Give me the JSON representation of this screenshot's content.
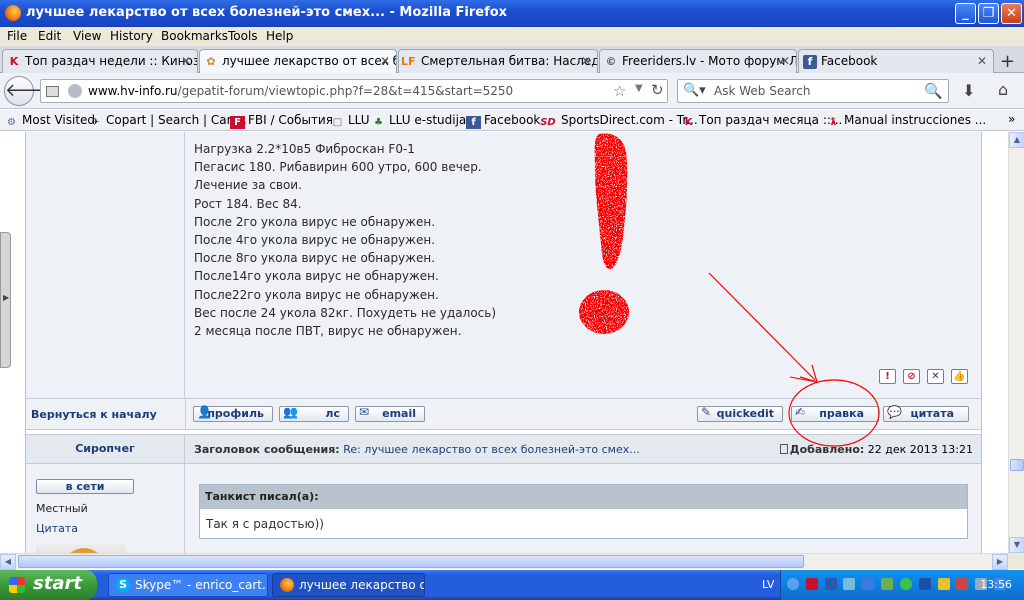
{
  "window": {
    "title": "лучшее лекарство от всех болезней-это смех... - Mozilla Firefox",
    "min_glyph": "_",
    "max_glyph": "❐",
    "close_glyph": "✕"
  },
  "menu": [
    "File",
    "Edit",
    "View",
    "History",
    "Bookmarks",
    "Tools",
    "Help"
  ],
  "tabs": [
    {
      "label": "Топ раздач недели :: Кинозал...",
      "icon_text": "K",
      "icon_color": "#c8102e"
    },
    {
      "label": "лучшее лекарство от всех бол...",
      "icon_text": "✿",
      "icon_color": "#d08a2a",
      "active": true
    },
    {
      "label": "Смертельная битва: Наследие...",
      "icon_text": "LF",
      "icon_color": "#e07b1a"
    },
    {
      "label": "Freeriders.lv - Мото форум Л...",
      "icon_text": "©",
      "icon_color": "#555555"
    },
    {
      "label": "Facebook",
      "icon_text": "f",
      "icon_color": "#3b5998"
    }
  ],
  "new_tab_glyph": "+",
  "nav": {
    "url_host": "www.hv-info.ru",
    "url_path": "/gepatit-forum/viewtopic.php?f=28&t=415&start=5250",
    "search_placeholder": "Ask Web Search"
  },
  "bookmarks": [
    {
      "label": "Most Visited",
      "icon": "⚙",
      "color": "#3b6fb6"
    },
    {
      "label": "Copart | Search | Car ...",
      "icon": "✈",
      "color": "#333333"
    },
    {
      "label": "FBI / События",
      "icon": "F",
      "color": "#c8102e"
    },
    {
      "label": "LLU",
      "icon": "□",
      "color": "#666666"
    },
    {
      "label": "LLU e-studijas",
      "icon": "♣",
      "color": "#2e7d32"
    },
    {
      "label": "Facebook",
      "icon": "f",
      "color": "#3b5998"
    },
    {
      "label": "SportsDirect.com - Tr...",
      "icon": "SD",
      "color": "#c8102e"
    },
    {
      "label": "Топ раздач месяца ::...",
      "icon": "K",
      "color": "#c8102e"
    },
    {
      "label": "Manual instrucciones ...",
      "icon": "ƛ",
      "color": "#c8102e"
    }
  ],
  "bookmarks_more": "»",
  "post1": {
    "lines": [
      "Нагрузка 2.2*10в5 Фиброскан F0-1",
      "Пегасис 180. Рибавирин 600 утро, 600 вечер.",
      "Лечение за свои.",
      "Рост 184. Вес 84.",
      "После 2го укола вирус не обнаружен.",
      "После 4го укола вирус не обнаружен.",
      "После 8го укола вирус не обнаружен.",
      "После14го укола вирус не обнаружен.",
      "После22го укола вирус не обнаружен.",
      "Вес после 24 укола 82кг. Похудеть не удалось)",
      "2 месяца после ПВТ, вирус не обнаружен."
    ],
    "back_to_top": "Вернуться к началу",
    "buttons": {
      "profile": "профиль",
      "pm": "лс",
      "email": "email",
      "quickedit": "quickedit",
      "edit": "правка",
      "quote": "цитата"
    },
    "mini_icons": [
      "!",
      "⊘",
      "✕",
      "👍"
    ]
  },
  "post2": {
    "author": "Сиропчег",
    "subject_label": "Заголовок сообщения:",
    "subject": "Re: лучшее лекарство от всех болезней-это смех...",
    "added_label": "Добавлено:",
    "added": "22 дек 2013 13:21",
    "online": "в сети",
    "rank": "Местный",
    "quote_link": "Цитата",
    "quote_author": "Танкист писал(а):",
    "quote_text": "Так я с радостью))"
  },
  "taskbar": {
    "start": "start",
    "tasks": [
      {
        "label": "Skype™ - enrico_cart...",
        "icon": "S",
        "color": "#00aff0"
      },
      {
        "label": "лучшее лекарство о...",
        "icon": "",
        "color": "#f07c12"
      }
    ],
    "lang": "LV",
    "clock": "13:56"
  },
  "colors": {
    "annotation": "#ff0000",
    "forum_link": "#1c3d7a"
  }
}
